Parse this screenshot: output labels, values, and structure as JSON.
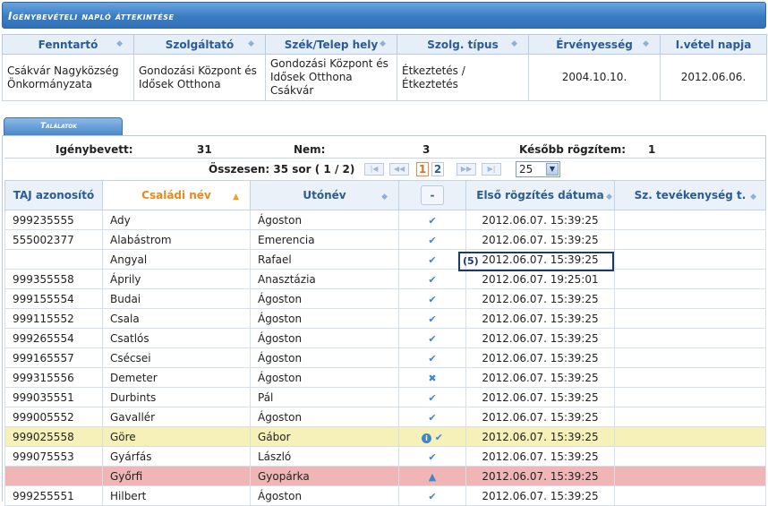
{
  "header": {
    "title": "Igénybevételi napló áttekintése"
  },
  "provider_table": {
    "columns": [
      "Fenntartó",
      "Szolgáltató",
      "Szék/Telep hely",
      "Szolg. típus",
      "Érvényesség",
      "I.vétel napja"
    ],
    "row": [
      "Csákvár Nagyközség Önkormányzata",
      "Gondozási Központ és Idősek Otthona",
      "Gondozási Központ és Idősek Otthona Csákvár",
      "Étkeztetés / Étkeztetés",
      "2004.10.10.",
      "2012.06.06."
    ]
  },
  "results_tab": {
    "label": "Találatok"
  },
  "stats": {
    "used_label": "Igénybevett:",
    "used_value": "31",
    "no_label": "Nem:",
    "no_value": "3",
    "later_label": "Később rögzítem:",
    "later_value": "1"
  },
  "pager": {
    "summary": "Összesen: 35 sor ( 1 / 2)",
    "page1": "1",
    "page2": "2",
    "rows_per_page": "25"
  },
  "grid": {
    "columns": [
      "TAJ azonosító",
      "Családi név",
      "Utónév",
      "-",
      "Első rögzítés dátuma",
      "Sz. tevékenység t."
    ],
    "rows": [
      {
        "taj": "999235555",
        "last": "Ady",
        "first": "Ágoston",
        "status": "check",
        "date": "2012.06.07. 15:39:25"
      },
      {
        "taj": "555002377",
        "last": "Alabástrom",
        "first": "Emerencia",
        "status": "check",
        "date": "2012.06.07. 15:39:25"
      },
      {
        "taj": "",
        "last": "Angyal",
        "first": "Rafael",
        "status": "check",
        "date": "2012.06.07. 15:39:25"
      },
      {
        "taj": "999355558",
        "last": "Áprily",
        "first": "Anasztázia",
        "status": "check",
        "date": "2012.06.07. 19:25:01"
      },
      {
        "taj": "999155554",
        "last": "Budai",
        "first": "Ágoston",
        "status": "check",
        "date": "2012.06.07. 15:39:25"
      },
      {
        "taj": "999115552",
        "last": "Csala",
        "first": "Ágoston",
        "status": "check",
        "date": "2012.06.07. 15:39:25"
      },
      {
        "taj": "999265554",
        "last": "Csatlós",
        "first": "Ágoston",
        "status": "check",
        "date": "2012.06.07. 15:39:25"
      },
      {
        "taj": "999165557",
        "last": "Csécsei",
        "first": "Ágoston",
        "status": "check",
        "date": "2012.06.07. 15:39:25"
      },
      {
        "taj": "999315556",
        "last": "Demeter",
        "first": "Ágoston",
        "status": "cross",
        "date": "2012.06.07. 15:39:25"
      },
      {
        "taj": "999035551",
        "last": "Durbints",
        "first": "Pál",
        "status": "check",
        "date": "2012.06.07. 15:39:25"
      },
      {
        "taj": "999005552",
        "last": "Gavallér",
        "first": "Ágoston",
        "status": "check",
        "date": "2012.06.07. 15:39:25"
      },
      {
        "taj": "999025558",
        "last": "Göre",
        "first": "Gábor",
        "status": "info-check",
        "date": "2012.06.07. 15:39:25",
        "highlight": "yellow"
      },
      {
        "taj": "999075553",
        "last": "Gyárfás",
        "first": "László",
        "status": "check",
        "date": "2012.06.07. 15:39:25"
      },
      {
        "taj": "",
        "last": "Győrfi",
        "first": "Gyopárka",
        "status": "warning",
        "date": "2012.06.07. 15:39:25",
        "highlight": "red"
      },
      {
        "taj": "999255551",
        "last": "Hilbert",
        "first": "Ágoston",
        "status": "check",
        "date": "2012.06.07. 15:39:25"
      }
    ]
  },
  "focus_marker": {
    "label": "(5)"
  },
  "colors": {
    "accent": "#3a7cc2",
    "header_text": "#2a5c96",
    "active_sort": "#e88a1a",
    "row_yellow": "#f5f1b8",
    "row_red": "#f0b5b5"
  }
}
